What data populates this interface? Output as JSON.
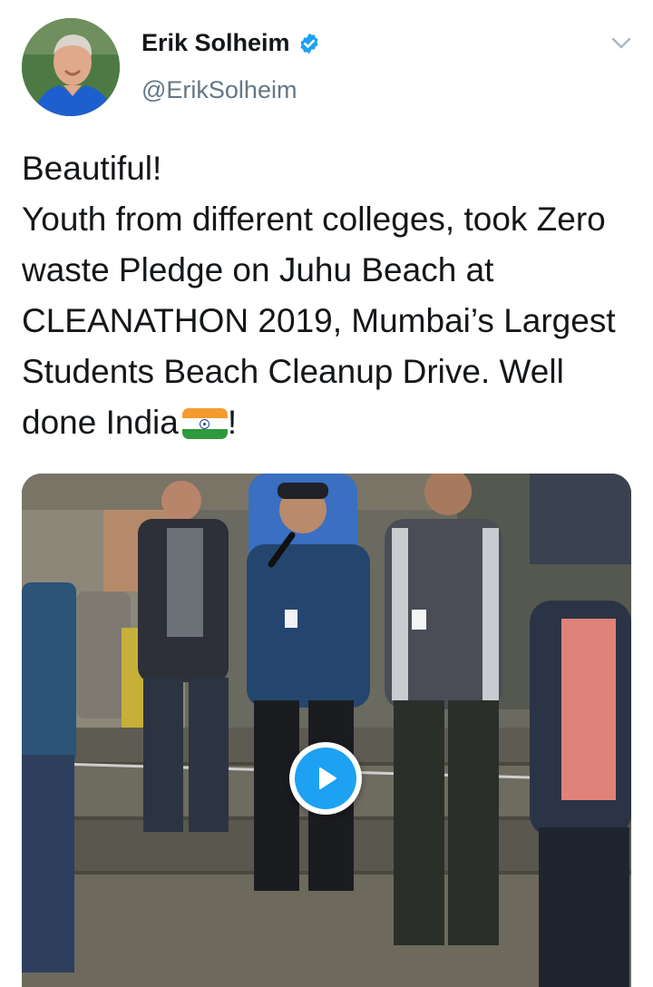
{
  "author": {
    "display_name": "Erik Solheim",
    "handle": "@ErikSolheim",
    "verified": true
  },
  "tweet": {
    "text": "Beautiful!\nYouth from different colleges, took Zero waste Pledge on Juhu Beach at CLEANATHON 2019, Mumbai’s Largest Students Beach Cleanup Drive. Well done India",
    "trailing_text": "!",
    "emoji": "india-flag"
  },
  "media": {
    "type": "video",
    "control": "play-icon"
  },
  "colors": {
    "accent": "#1da1f2",
    "text": "#14171a",
    "secondary": "#657786"
  },
  "icons": {
    "verified": "verified-badge-icon",
    "menu": "chevron-down-icon"
  }
}
